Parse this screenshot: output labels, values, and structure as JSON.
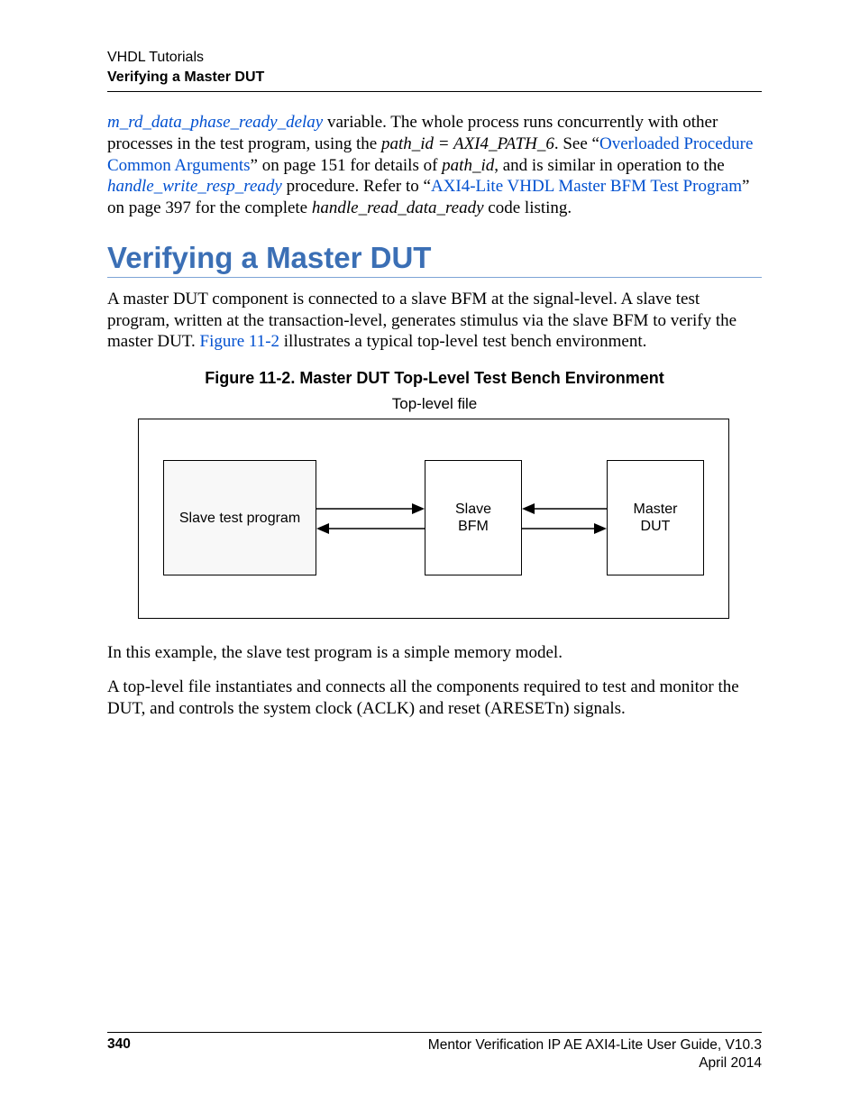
{
  "header": {
    "line1": "VHDL Tutorials",
    "line2": "Verifying a Master DUT"
  },
  "para1": {
    "link1": "m_rd_data_phase_ready_delay",
    "t1": " variable. The whole process runs concurrently with other processes in the test program, using the ",
    "em1": "path_id = AXI4_PATH_6",
    "t2": ". See “",
    "link2": "Overloaded Procedure Common Arguments",
    "t3": "” on page 151 for details of ",
    "em2": "path_id",
    "t4": ", and is similar in operation to the ",
    "link3": "handle_write_resp_ready",
    "t5": " procedure. Refer to  “",
    "link4": "AXI4-Lite VHDL Master BFM Test Program",
    "t6": "” on page 397 for the complete ",
    "em3": "handle_read_data_ready",
    "t7": " code listing."
  },
  "heading": "Verifying a Master DUT",
  "para2": {
    "t1": "A master DUT component is connected to a slave BFM at the signal-level. A slave test program, written at the transaction-level, generates stimulus via the slave BFM to verify the master DUT. ",
    "link1": "Figure 11-2",
    "t2": " illustrates a typical top-level test bench environment."
  },
  "figure": {
    "caption": "Figure 11-2. Master DUT Top-Level Test Bench Environment",
    "top_label": "Top-level file",
    "box_slave_test": "Slave test program",
    "box_slave_bfm_l1": "Slave",
    "box_slave_bfm_l2": "BFM",
    "box_master_dut_l1": "Master",
    "box_master_dut_l2": "DUT"
  },
  "para3": "In this example, the slave test program is a simple memory model.",
  "para4": "A top-level file instantiates and connects all the components required to test and monitor the DUT, and controls the system clock (ACLK) and reset (ARESETn) signals.",
  "footer": {
    "page": "340",
    "right1": "Mentor Verification IP AE AXI4-Lite User Guide, V10.3",
    "right2": "April 2014"
  }
}
